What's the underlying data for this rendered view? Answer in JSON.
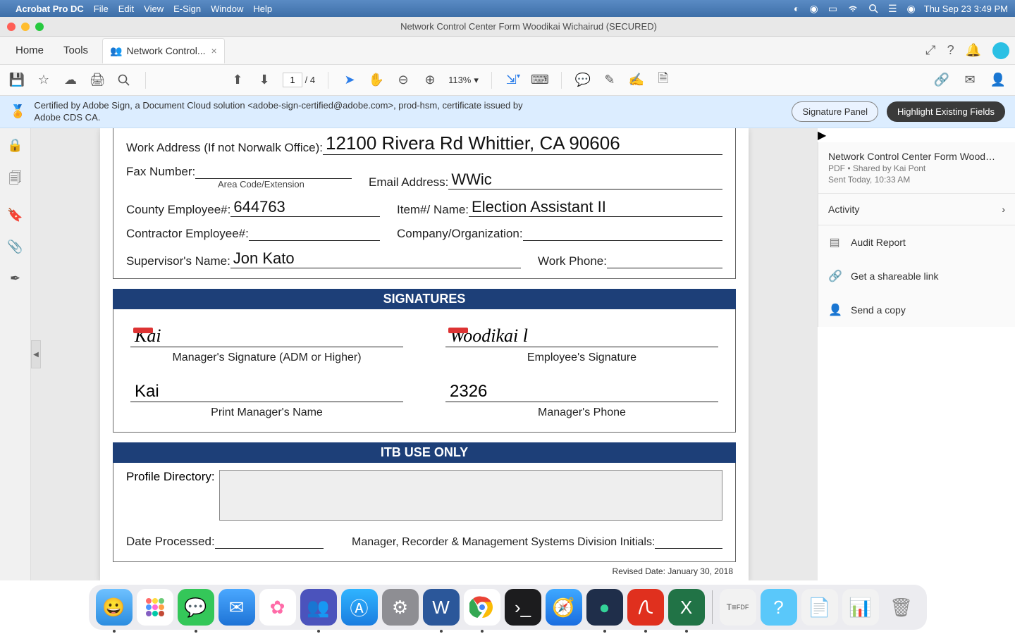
{
  "menubar": {
    "app": "Acrobat Pro DC",
    "items": [
      "File",
      "Edit",
      "View",
      "E-Sign",
      "Window",
      "Help"
    ],
    "clock": "Thu Sep 23  3:49 PM"
  },
  "window": {
    "title": "Network Control Center Form Woodikai Wichairud (SECURED)"
  },
  "tabs": {
    "home": "Home",
    "tools": "Tools",
    "doc": "Network Control..."
  },
  "toolbar": {
    "page_cur": "1",
    "page_tot": "4",
    "zoom": "113%"
  },
  "certbar": {
    "msg": "Certified by Adobe Sign, a Document Cloud solution <adobe-sign-certified@adobe.com>, prod-hsm, certificate issued by Adobe CDS CA.",
    "btn_panel": "Signature Panel",
    "btn_highlight": "Highlight Existing Fields"
  },
  "form": {
    "work_address_lbl": "Work Address (If not Norwalk Office):",
    "work_address_val": "12100 Rivera Rd Whittier, CA 90606",
    "fax_lbl": "Fax Number:",
    "fax_hint": "Area Code/Extension",
    "email_lbl": "Email Address:",
    "email_val": "WWic",
    "county_emp_lbl": "County Employee#:",
    "county_emp_val": "644763",
    "item_lbl": "Item#/ Name:",
    "item_val": "Election Assistant II",
    "contractor_lbl": "Contractor Employee#:",
    "company_lbl": "Company/Organization:",
    "supervisor_lbl": "Supervisor's Name:",
    "supervisor_val": "Jon Kato",
    "workphone_lbl": "Work Phone:",
    "sig_header": "SIGNATURES",
    "mgr_sig_val": "Kai",
    "mgr_sig_cap": "Manager's Signature (ADM or Higher)",
    "emp_sig_val": "Woodikai l",
    "emp_sig_cap": "Employee's Signature",
    "mgr_name_val": "Kai",
    "mgr_name_cap": "Print Manager's Name",
    "mgr_phone_val": "2326",
    "mgr_phone_cap": "Manager's Phone",
    "itb_header": "ITB USE ONLY",
    "profile_lbl": "Profile Directory:",
    "date_proc_lbl": "Date Processed:",
    "initials_lbl": "Manager, Recorder & Management Systems Division Initials:",
    "revised": "Revised Date: January 30, 2018"
  },
  "rightpanel": {
    "title": "Network Control Center Form Wood…",
    "sub1": "PDF  •  Shared by Kai Pont",
    "sub2": "Sent Today, 10:33 AM",
    "activity": "Activity",
    "audit": "Audit Report",
    "share": "Get a shareable link",
    "send": "Send a copy"
  }
}
